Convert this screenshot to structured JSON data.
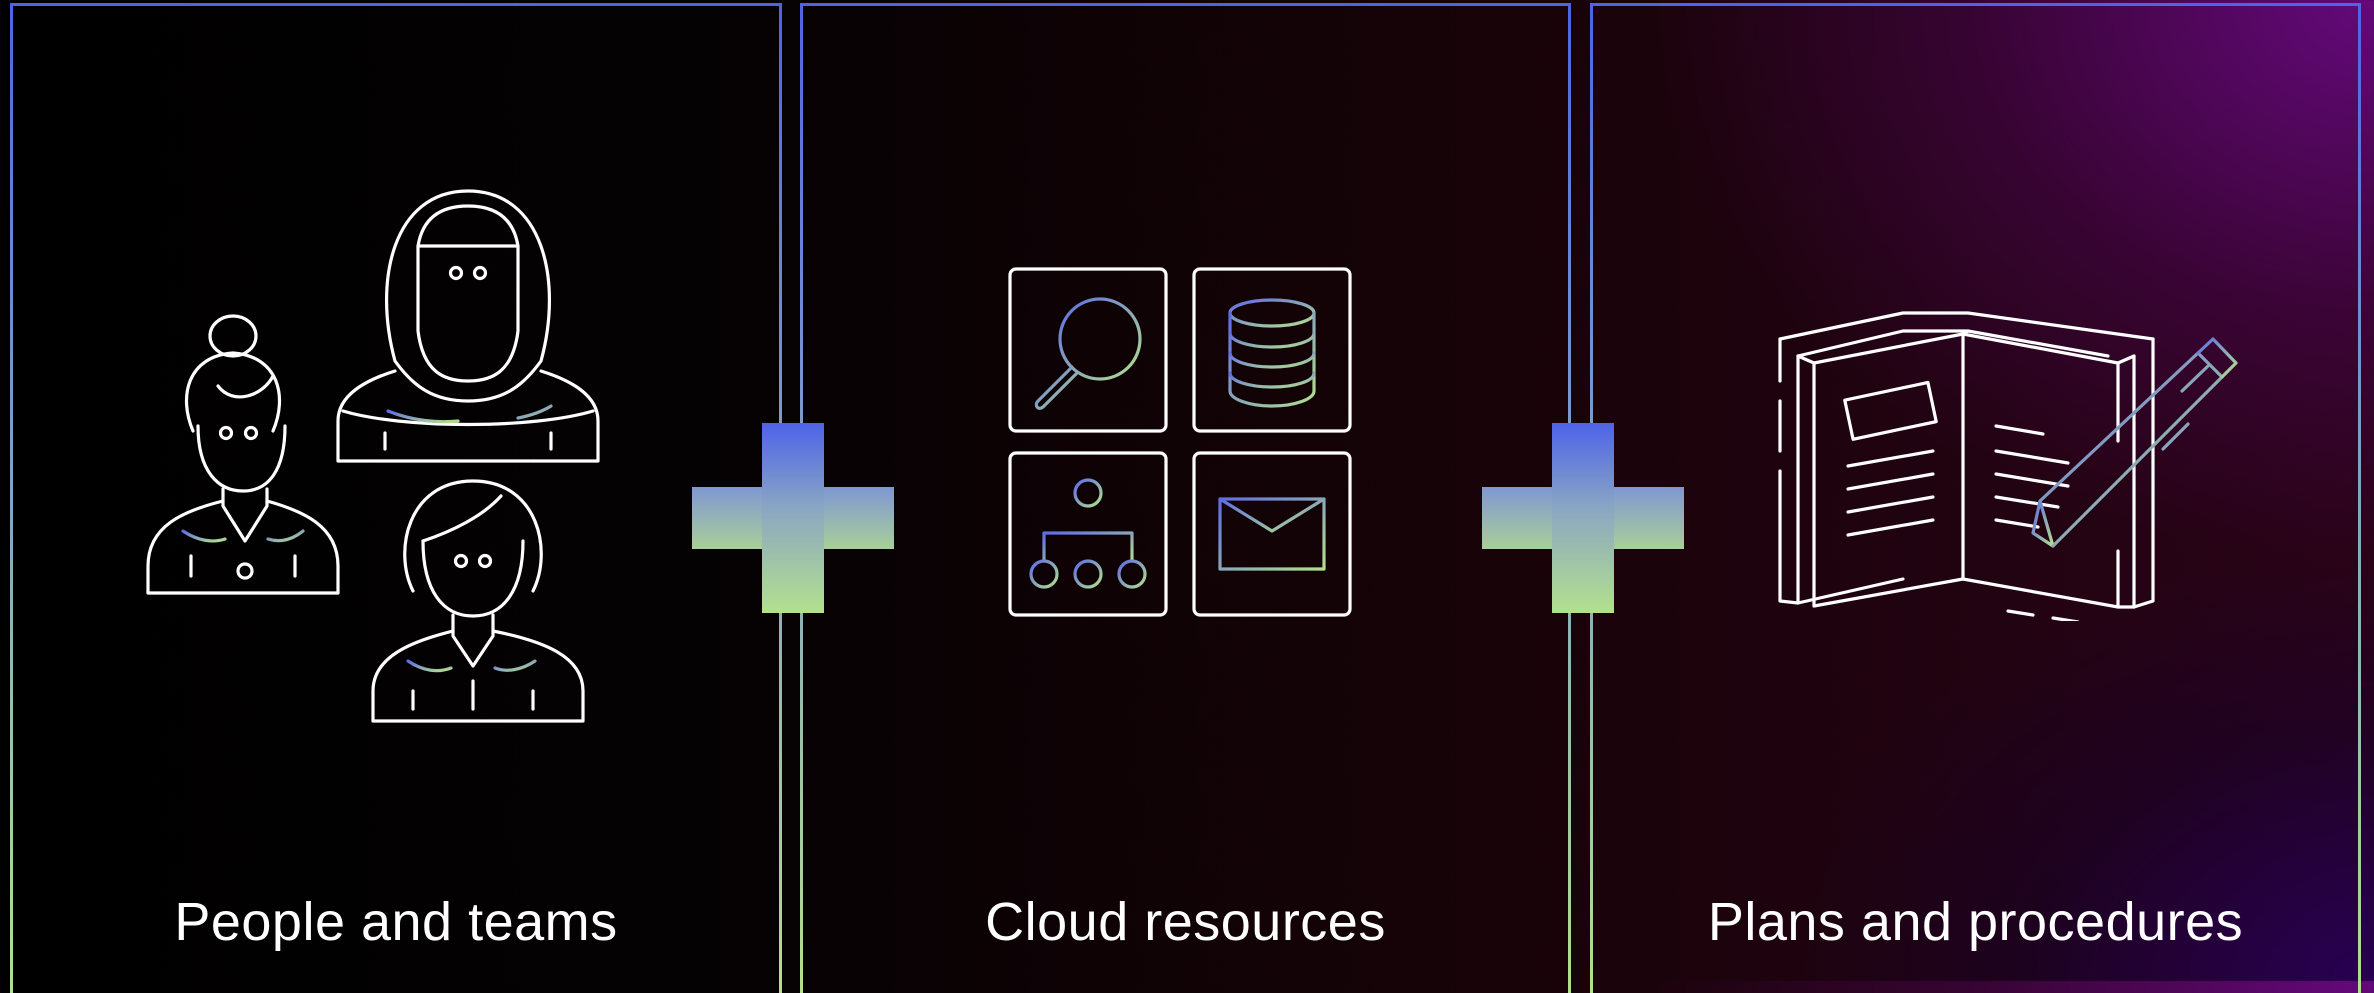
{
  "panels": [
    {
      "label": "People and teams",
      "icon": "people-icon"
    },
    {
      "label": "Cloud resources",
      "icon": "cloud-resources-icon"
    },
    {
      "label": "Plans and procedures",
      "icon": "plans-book-icon"
    }
  ],
  "connectors": [
    "plus-icon",
    "plus-icon"
  ],
  "colors": {
    "accent_blue": "#4f63e6",
    "accent_green": "#b3e08d",
    "line_white": "#ffffff",
    "background_purple": "#5a0a7a"
  }
}
